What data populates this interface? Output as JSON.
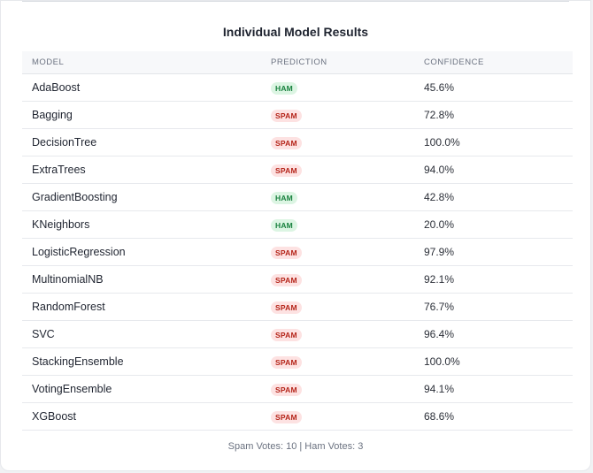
{
  "title": "Individual Model Results",
  "columns": {
    "model": "MODEL",
    "prediction": "PREDICTION",
    "confidence": "CONFIDENCE"
  },
  "rows": [
    {
      "model": "AdaBoost",
      "prediction": "HAM",
      "confidence": "45.6%"
    },
    {
      "model": "Bagging",
      "prediction": "SPAM",
      "confidence": "72.8%"
    },
    {
      "model": "DecisionTree",
      "prediction": "SPAM",
      "confidence": "100.0%"
    },
    {
      "model": "ExtraTrees",
      "prediction": "SPAM",
      "confidence": "94.0%"
    },
    {
      "model": "GradientBoosting",
      "prediction": "HAM",
      "confidence": "42.8%"
    },
    {
      "model": "KNeighbors",
      "prediction": "HAM",
      "confidence": "20.0%"
    },
    {
      "model": "LogisticRegression",
      "prediction": "SPAM",
      "confidence": "97.9%"
    },
    {
      "model": "MultinomialNB",
      "prediction": "SPAM",
      "confidence": "92.1%"
    },
    {
      "model": "RandomForest",
      "prediction": "SPAM",
      "confidence": "76.7%"
    },
    {
      "model": "SVC",
      "prediction": "SPAM",
      "confidence": "96.4%"
    },
    {
      "model": "StackingEnsemble",
      "prediction": "SPAM",
      "confidence": "100.0%"
    },
    {
      "model": "VotingEnsemble",
      "prediction": "SPAM",
      "confidence": "94.1%"
    },
    {
      "model": "XGBoost",
      "prediction": "SPAM",
      "confidence": "68.6%"
    }
  ],
  "footer": "Spam Votes: 10 | Ham Votes: 3",
  "colors": {
    "spam_bg": "#fde2e2",
    "spam_text": "#b42318",
    "ham_bg": "#dcf5e3",
    "ham_text": "#17803d"
  }
}
